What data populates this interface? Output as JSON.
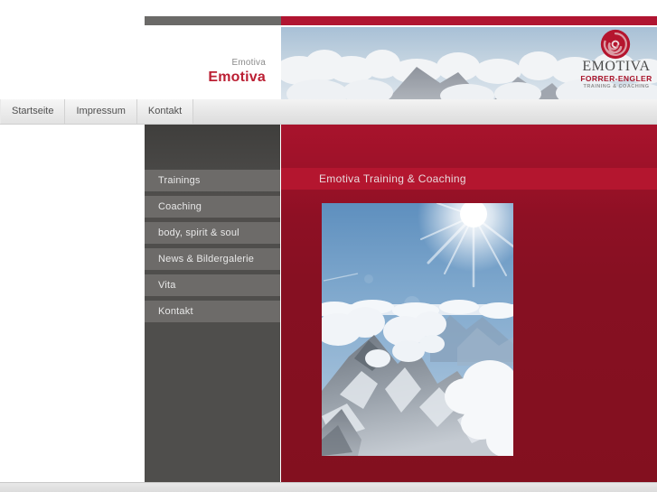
{
  "header": {
    "site_label_small": "Emotiva",
    "site_label_big": "Emotiva",
    "logo": {
      "icon": "spiral-icon",
      "name": "EMOTIVA",
      "subtitle": "FORRER-ENGLER",
      "tagline": "TRAINING & COACHING"
    },
    "banner_image_alt": "clouds-and-mountain-panorama"
  },
  "topnav": {
    "tabs": [
      {
        "label": "Startseite"
      },
      {
        "label": "Impressum"
      },
      {
        "label": "Kontakt"
      }
    ]
  },
  "sidebar": {
    "items": [
      {
        "label": "Trainings"
      },
      {
        "label": "Coaching"
      },
      {
        "label": "body, spirit & soul"
      },
      {
        "label": "News & Bildergalerie"
      },
      {
        "label": "Vita"
      },
      {
        "label": "Kontakt"
      }
    ]
  },
  "content": {
    "heading": "Emotiva Training & Coaching",
    "image_alt": "sunlit-snowy-mountain-above-clouds"
  },
  "colors": {
    "accent_red": "#b01531",
    "panel_red": "#8e1024",
    "heading_red": "#b4162f",
    "sidebar_gray": "#4f4e4c",
    "nav_item_gray": "#6d6b69",
    "brand_red_text": "#bb1f33",
    "muted_gray_text": "#8b8b8b"
  }
}
